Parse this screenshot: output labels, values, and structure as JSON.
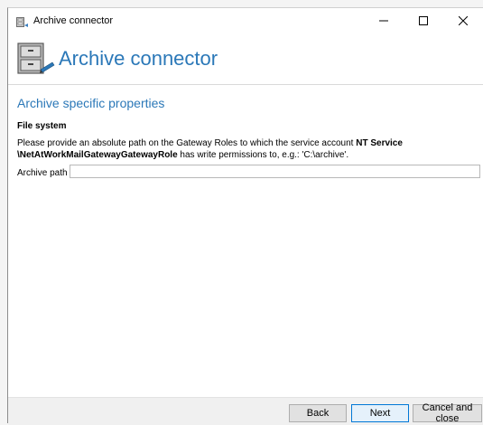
{
  "window": {
    "title": "Archive connector",
    "controls": {
      "minimize": "minimize-icon",
      "maximize": "maximize-icon",
      "close": "close-icon"
    }
  },
  "header": {
    "title": "Archive connector",
    "icon": "file-cabinet-icon"
  },
  "main": {
    "section_title": "Archive specific properties",
    "group_title": "File system",
    "description_prefix": "Please provide an absolute path on the Gateway Roles to which the service account ",
    "description_account": "NT Service \\NetAtWorkMailGatewayGatewayRole",
    "description_suffix": " has write permissions to, e.g.: 'C:\\archive'.",
    "archive_path_label": "Archive path",
    "archive_path_value": ""
  },
  "footer": {
    "back_label": "Back",
    "next_label": "Next",
    "cancel_label": "Cancel and close"
  },
  "colors": {
    "accent": "#2b78b8",
    "default_button_border": "#0078d7"
  }
}
